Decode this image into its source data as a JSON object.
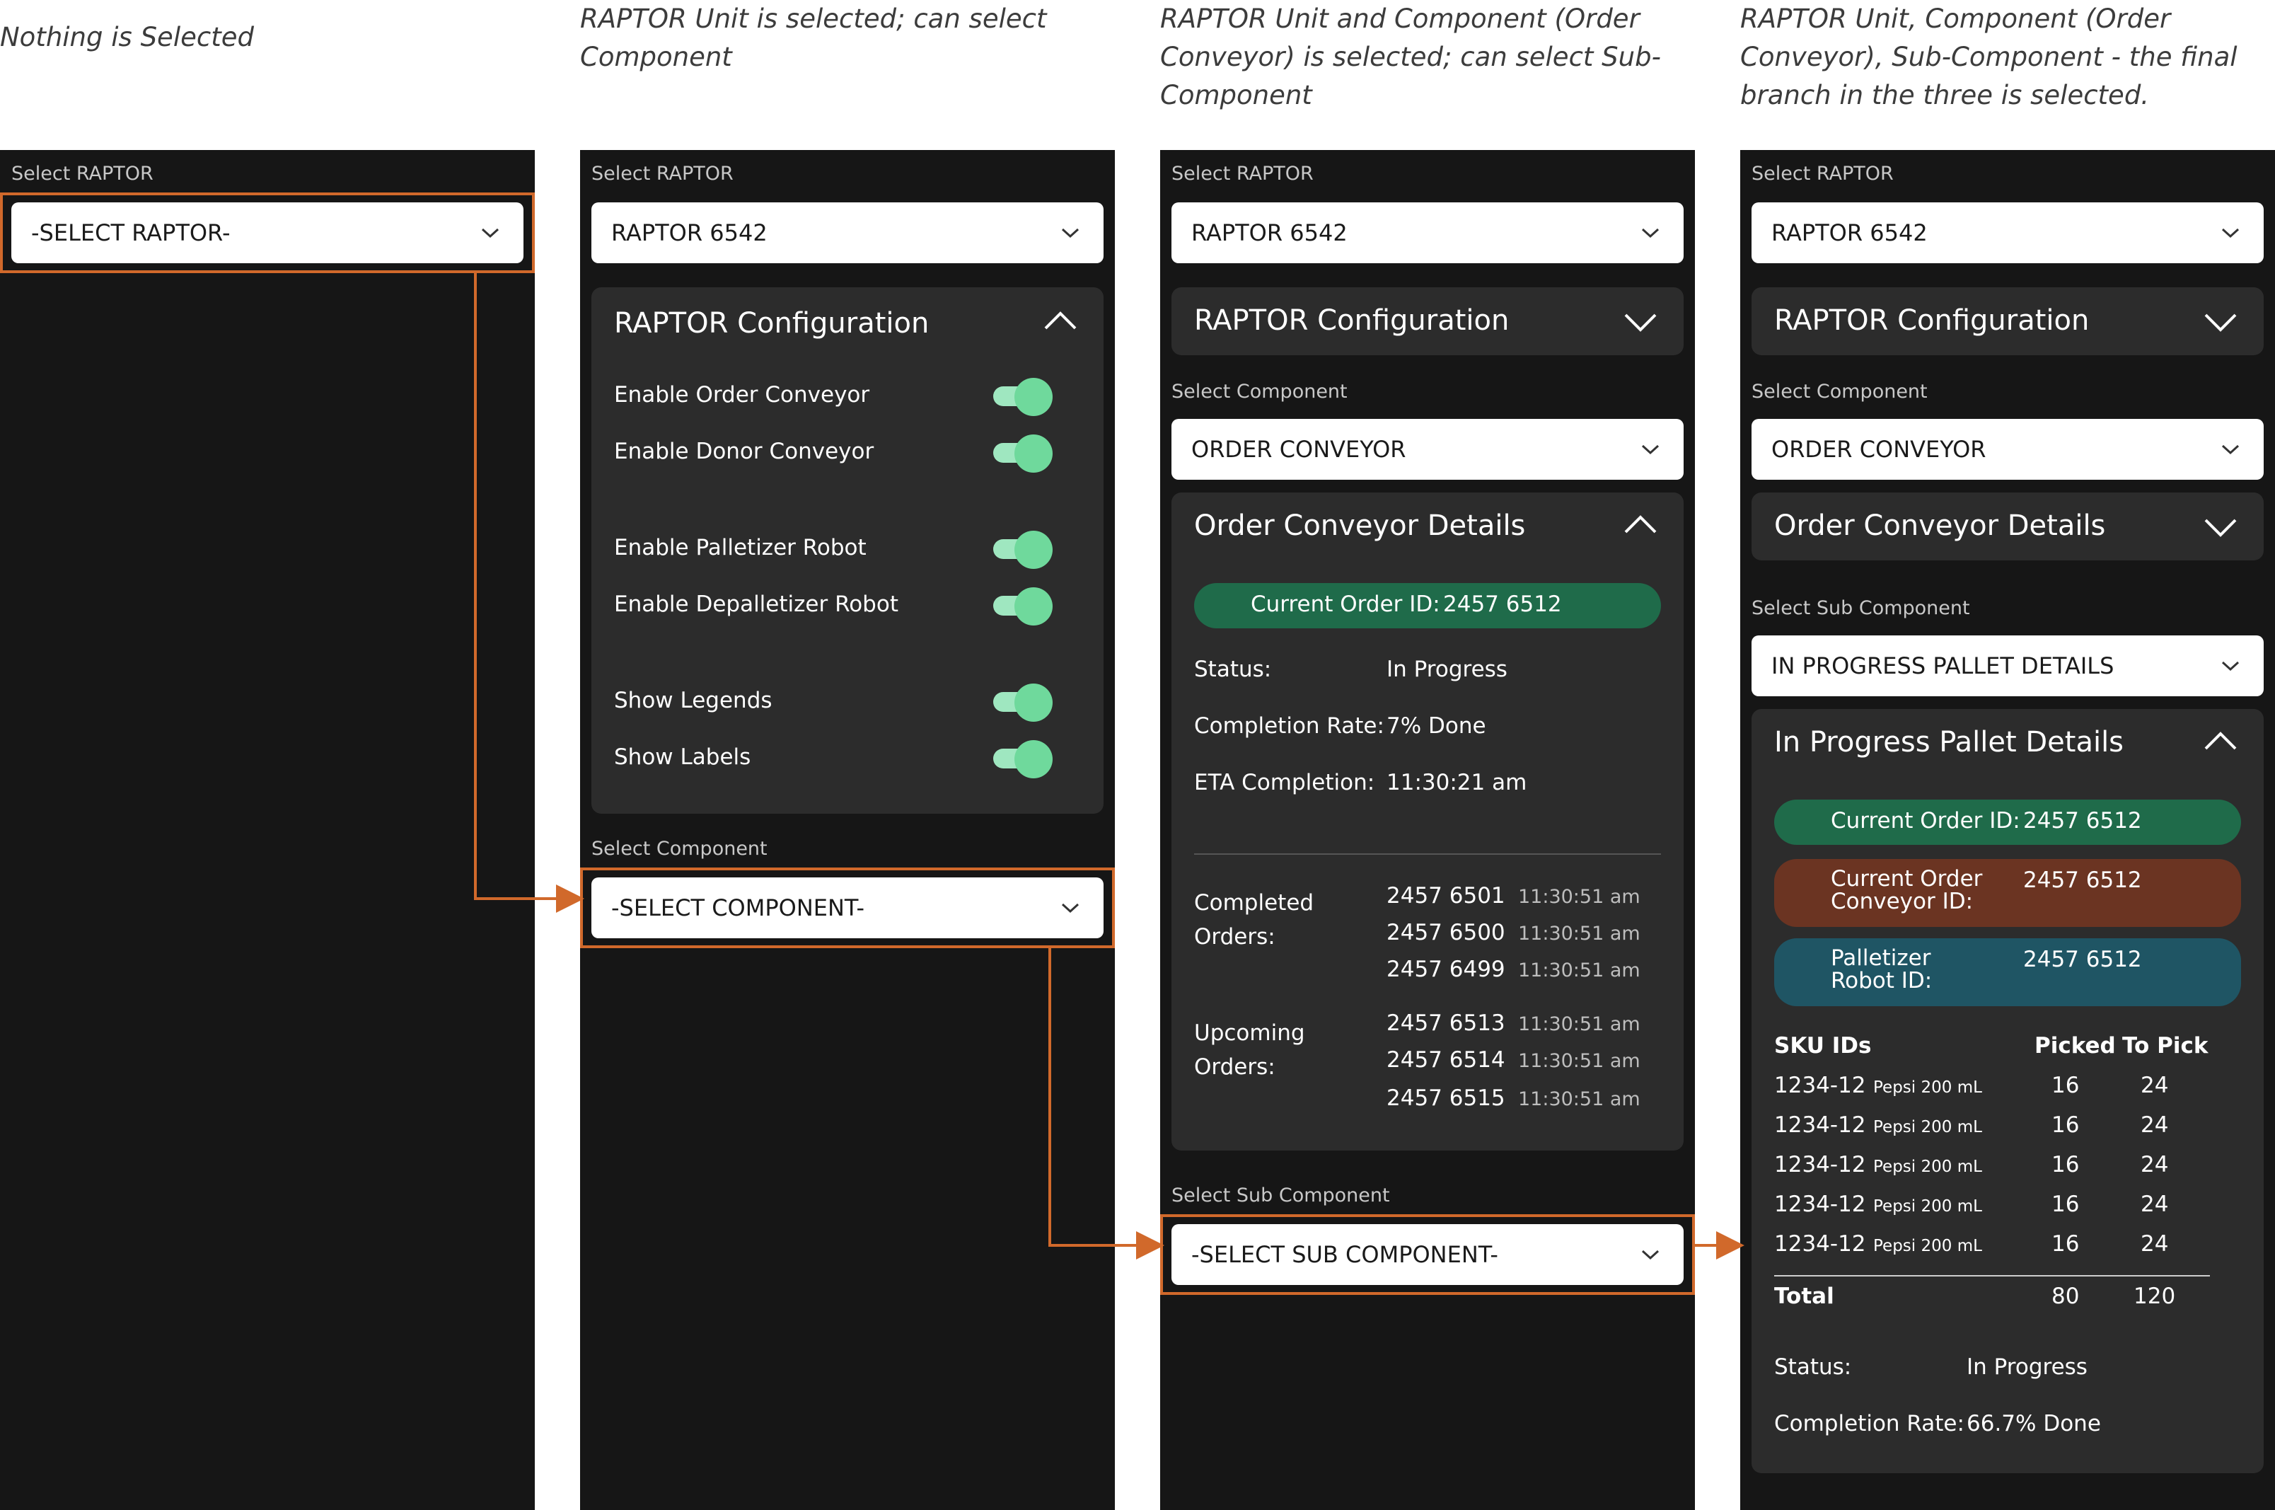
{
  "colors": {
    "accent": "#d1692b",
    "toggle_on": "#6fd99c",
    "pill_green": "#1f6b4a",
    "pill_brown": "#6b3422",
    "pill_teal": "#1f5564"
  },
  "captions": [
    "Nothing is Selected",
    "RAPTOR Unit is selected; can select Component",
    "RAPTOR Unit and Component (Order Conveyor) is selected; can select Sub-Component",
    "RAPTOR Unit, Component (Order Conveyor), Sub-Component - the final branch in the three is selected."
  ],
  "panel1": {
    "raptor_label": "Select RAPTOR",
    "raptor_value": "-SELECT RAPTOR-"
  },
  "panel2": {
    "raptor_label": "Select RAPTOR",
    "raptor_value": "RAPTOR 6542",
    "config_title": "RAPTOR Configuration",
    "toggles": [
      {
        "label": "Enable Order Conveyor",
        "on": true
      },
      {
        "label": "Enable Donor Conveyor",
        "on": true
      },
      {
        "label": "Enable Palletizer Robot",
        "on": true
      },
      {
        "label": "Enable Depalletizer Robot",
        "on": true
      },
      {
        "label": "Show Legends",
        "on": true
      },
      {
        "label": "Show Labels",
        "on": true
      }
    ],
    "component_label": "Select Component",
    "component_value": "-SELECT COMPONENT-"
  },
  "panel3": {
    "raptor_label": "Select RAPTOR",
    "raptor_value": "RAPTOR 6542",
    "config_title": "RAPTOR Configuration",
    "component_label": "Select Component",
    "component_value": "ORDER CONVEYOR",
    "details_title": "Order Conveyor Details",
    "current_order_key": "Current Order ID:",
    "current_order_value": "2457 6512",
    "status_key": "Status:",
    "status_value": "In Progress",
    "rate_key": "Completion Rate:",
    "rate_value": "7%  Done",
    "eta_key": "ETA Completion:",
    "eta_value": "11:30:21 am",
    "completed_key_1": "Completed",
    "completed_key_2": "Orders:",
    "completed": [
      {
        "id": "2457 6501",
        "time": "11:30:51 am"
      },
      {
        "id": "2457 6500",
        "time": "11:30:51 am"
      },
      {
        "id": "2457 6499",
        "time": "11:30:51 am"
      }
    ],
    "upcoming_key_1": "Upcoming",
    "upcoming_key_2": "Orders:",
    "upcoming": [
      {
        "id": "2457 6513",
        "time": "11:30:51 am"
      },
      {
        "id": "2457 6514",
        "time": "11:30:51 am"
      },
      {
        "id": "2457 6515",
        "time": "11:30:51 am"
      }
    ],
    "sub_label": "Select Sub Component",
    "sub_value": "-SELECT SUB COMPONENT-"
  },
  "panel4": {
    "raptor_label": "Select RAPTOR",
    "raptor_value": "RAPTOR 6542",
    "config_title": "RAPTOR Configuration",
    "component_label": "Select Component",
    "component_value": "ORDER CONVEYOR",
    "details_title": "Order Conveyor Details",
    "sub_label": "Select Sub Component",
    "sub_value": "IN PROGRESS PALLET DETAILS",
    "pallet_title": "In Progress Pallet Details",
    "pill1_key": "Current Order ID:",
    "pill1_value": "2457 6512",
    "pill2_key_1": "Current Order",
    "pill2_key_2": "Conveyor ID:",
    "pill2_value": "2457 6512",
    "pill3_key_1": "Palletizer",
    "pill3_key_2": "Robot ID:",
    "pill3_value": "2457 6512",
    "sku_header": "SKU IDs",
    "picked_header": "Picked",
    "topick_header": "To Pick",
    "skus": [
      {
        "id": "1234-12",
        "name": "Pepsi 200 mL",
        "picked": "16",
        "to_pick": "24"
      },
      {
        "id": "1234-12",
        "name": "Pepsi 200 mL",
        "picked": "16",
        "to_pick": "24"
      },
      {
        "id": "1234-12",
        "name": "Pepsi 200 mL",
        "picked": "16",
        "to_pick": "24"
      },
      {
        "id": "1234-12",
        "name": "Pepsi 200 mL",
        "picked": "16",
        "to_pick": "24"
      },
      {
        "id": "1234-12",
        "name": "Pepsi 200 mL",
        "picked": "16",
        "to_pick": "24"
      }
    ],
    "total_label": "Total",
    "total_picked": "80",
    "total_topick": "120",
    "status_key": "Status:",
    "status_value": "In Progress",
    "rate_key": "Completion Rate:",
    "rate_value": "66.7%  Done"
  }
}
